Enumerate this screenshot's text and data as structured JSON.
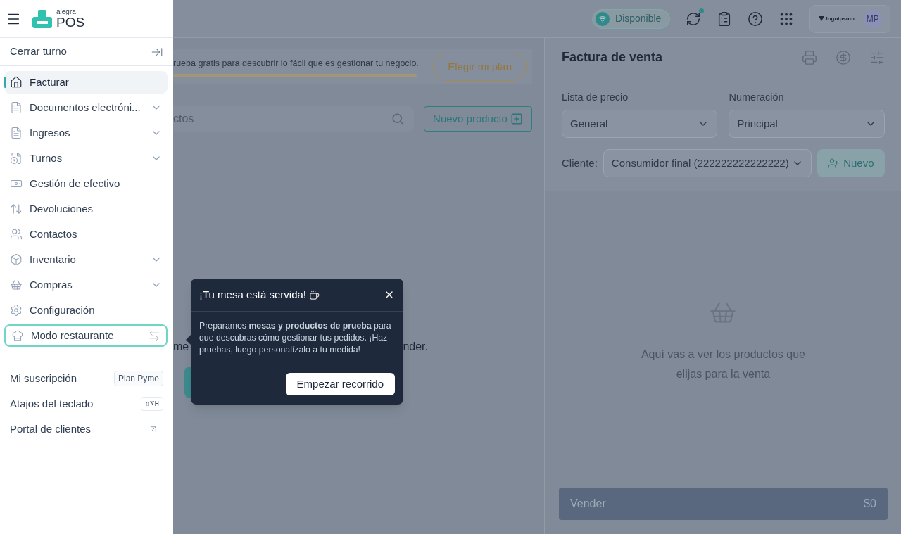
{
  "sidebar": {
    "logo": {
      "small": "alegra",
      "large": "POS"
    },
    "close_shift": {
      "label": "Cerrar turno"
    },
    "items": [
      {
        "label": "Facturar",
        "kind": "link",
        "selected": true
      },
      {
        "label": "Documentos electróni...",
        "kind": "group",
        "selected": false
      },
      {
        "label": "Ingresos",
        "kind": "group",
        "selected": false
      },
      {
        "label": "Turnos",
        "kind": "group",
        "selected": false
      },
      {
        "label": "Gestión de efectivo",
        "kind": "link",
        "selected": false
      },
      {
        "label": "Devoluciones",
        "kind": "link",
        "selected": false
      },
      {
        "label": "Contactos",
        "kind": "link",
        "selected": false
      },
      {
        "label": "Inventario",
        "kind": "group",
        "selected": false
      },
      {
        "label": "Compras",
        "kind": "group",
        "selected": false
      },
      {
        "label": "Configuración",
        "kind": "link",
        "selected": false
      },
      {
        "label": "Modo restaurante",
        "kind": "toggle",
        "selected": false
      }
    ],
    "footer": [
      {
        "label": "Mi suscripción",
        "kind": "badge",
        "tag": "Plan Pyme"
      },
      {
        "label": "Atajos del teclado",
        "kind": "shortcut",
        "tag": "⇧⌥H"
      },
      {
        "label": "Portal de clientes",
        "kind": "external"
      }
    ]
  },
  "header": {
    "status": "Disponible",
    "company_logo": "logoipsum",
    "avatar": "MP",
    "sync_alert": true
  },
  "banner": {
    "text": "rueba gratis para descubrir lo fácil que es gestionar tu negocio.",
    "level": 1,
    "button": "Elegir mi plan"
  },
  "search": {
    "placeholder": "ctos"
  },
  "new_product_button": "Nuevo producto",
  "empty_fragments": {
    "left": "me",
    "right": "nder."
  },
  "tooltip": {
    "title": "¡Tu mesa está servida!",
    "body": "Preparamos **mesas y productos de prueba** para que descubras cómo gestionar tus pedidos. ¡Haz pruebas, luego personalízalo a tu medida!",
    "button": "Empezar recorrido"
  },
  "invoice": {
    "title": "Factura de venta",
    "price_list": {
      "label": "Lista de precio",
      "value": "General"
    },
    "numbering": {
      "label": "Numeración",
      "value": "Principal"
    },
    "client": {
      "label": "Cliente:",
      "value": "Consumidor final (222222222222222)",
      "button": "Nuevo"
    },
    "empty_text": "Aquí vas a ver los productos que elijas para la venta",
    "sell_button": {
      "label": "Vender",
      "total": "$0"
    }
  }
}
